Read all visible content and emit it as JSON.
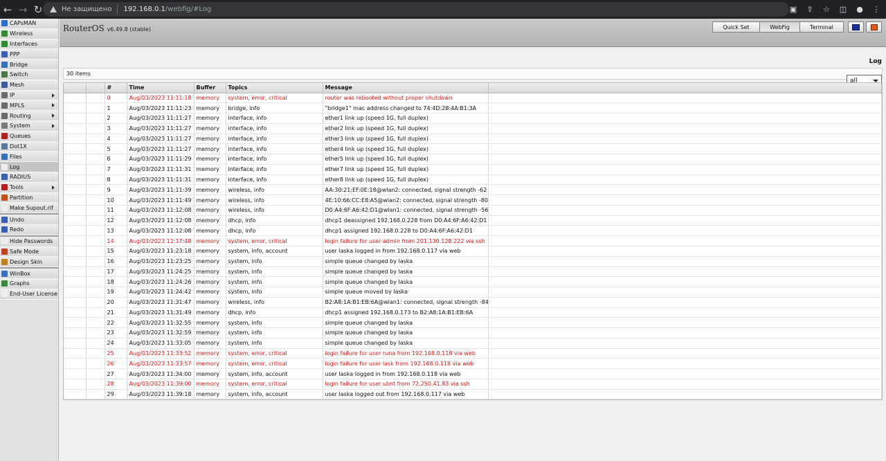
{
  "browser": {
    "security_label": "Не защищено",
    "url_host": "192.168.0.1",
    "url_path": "/webfig/#Log"
  },
  "sidebar": {
    "items": [
      {
        "label": "CAPsMAN",
        "icon": "capsman-icon",
        "color": "#2a6fc9",
        "arrow": false
      },
      {
        "label": "Wireless",
        "icon": "wireless-icon",
        "color": "#3a8a3a",
        "arrow": false
      },
      {
        "label": "Interfaces",
        "icon": "interfaces-icon",
        "color": "#2d8c2d",
        "arrow": false
      },
      {
        "label": "PPP",
        "icon": "ppp-icon",
        "color": "#3a5fb0",
        "arrow": false
      },
      {
        "label": "Bridge",
        "icon": "bridge-icon",
        "color": "#3a6fb8",
        "arrow": false
      },
      {
        "label": "Switch",
        "icon": "switch-icon",
        "color": "#4a7a4a",
        "arrow": false
      },
      {
        "label": "Mesh",
        "icon": "mesh-icon",
        "color": "#3a5f9a",
        "arrow": false
      },
      {
        "label": "IP",
        "icon": "ip-icon",
        "color": "#6a6a6a",
        "arrow": true
      },
      {
        "label": "MPLS",
        "icon": "mpls-icon",
        "color": "#6a6a6a",
        "arrow": true
      },
      {
        "label": "Routing",
        "icon": "routing-icon",
        "color": "#6a6a6a",
        "arrow": true
      },
      {
        "label": "System",
        "icon": "system-icon",
        "color": "#7a7a7a",
        "arrow": true
      },
      {
        "label": "Queues",
        "icon": "queues-icon",
        "color": "#b02020",
        "arrow": false
      },
      {
        "label": "Dot1X",
        "icon": "dot1x-icon",
        "color": "#5a7a9a",
        "arrow": false
      },
      {
        "label": "Files",
        "icon": "files-icon",
        "color": "#3a6fb8",
        "arrow": false
      },
      {
        "label": "Log",
        "icon": "log-icon",
        "color": "#eeeeee",
        "arrow": false,
        "active": true
      },
      {
        "label": "RADIUS",
        "icon": "radius-icon",
        "color": "#3a5fb0",
        "arrow": false
      },
      {
        "label": "Tools",
        "icon": "tools-icon",
        "color": "#b02020",
        "arrow": true
      },
      {
        "label": "Partition",
        "icon": "partition-icon",
        "color": "#c05020",
        "arrow": false
      },
      {
        "label": "Make Supout.rif",
        "icon": "supout-icon",
        "color": "#eeeeee",
        "arrow": false
      }
    ],
    "group2": [
      {
        "label": "Undo",
        "icon": "undo-icon",
        "color": "#3a5fb0"
      },
      {
        "label": "Redo",
        "icon": "redo-icon",
        "color": "#3a5fb0"
      }
    ],
    "group3": [
      {
        "label": "Hide Passwords",
        "icon": "hide-passwords-icon",
        "color": "#eeeeee"
      },
      {
        "label": "Safe Mode",
        "icon": "safe-mode-icon",
        "color": "#c04020"
      },
      {
        "label": "Design Skin",
        "icon": "design-skin-icon",
        "color": "#c08020"
      }
    ],
    "group4": [
      {
        "label": "WinBox",
        "icon": "winbox-icon",
        "color": "#3a6fb8"
      },
      {
        "label": "Graphs",
        "icon": "graphs-icon",
        "color": "#3a8a3a"
      },
      {
        "label": "End-User License",
        "icon": "license-icon",
        "color": "#eeeeee"
      }
    ]
  },
  "header": {
    "brand": "RouterOS",
    "version": "v6.49.8 (stable)",
    "tabs": {
      "quick_set": "Quick Set",
      "webfig": "WebFig",
      "terminal": "Terminal"
    }
  },
  "page": {
    "title": "Log",
    "items_count": "30 items",
    "filter_value": "all"
  },
  "table": {
    "columns": [
      "",
      "",
      "#",
      "Time",
      "Buffer",
      "Topics",
      "Message",
      ""
    ],
    "rows": [
      {
        "n": "0",
        "time": "Aug/03/2023 11:11:18",
        "buffer": "memory",
        "topics": "system, error, critical",
        "message": "router was rebooted without proper shutdown",
        "error": true
      },
      {
        "n": "1",
        "time": "Aug/03/2023 11:11:23",
        "buffer": "memory",
        "topics": "bridge, info",
        "message": "\"bridge1\" mac address changed to 74:4D:28:4A:B1:3A",
        "error": false
      },
      {
        "n": "2",
        "time": "Aug/03/2023 11:11:27",
        "buffer": "memory",
        "topics": "interface, info",
        "message": "ether1 link up (speed 1G, full duplex)",
        "error": false
      },
      {
        "n": "3",
        "time": "Aug/03/2023 11:11:27",
        "buffer": "memory",
        "topics": "interface, info",
        "message": "ether2 link up (speed 1G, full duplex)",
        "error": false
      },
      {
        "n": "4",
        "time": "Aug/03/2023 11:11:27",
        "buffer": "memory",
        "topics": "interface, info",
        "message": "ether3 link up (speed 1G, full duplex)",
        "error": false
      },
      {
        "n": "5",
        "time": "Aug/03/2023 11:11:27",
        "buffer": "memory",
        "topics": "interface, info",
        "message": "ether4 link up (speed 1G, full duplex)",
        "error": false
      },
      {
        "n": "6",
        "time": "Aug/03/2023 11:11:29",
        "buffer": "memory",
        "topics": "interface, info",
        "message": "ether5 link up (speed 1G, full duplex)",
        "error": false
      },
      {
        "n": "7",
        "time": "Aug/03/2023 11:11:31",
        "buffer": "memory",
        "topics": "interface, info",
        "message": "ether7 link up (speed 1G, full duplex)",
        "error": false
      },
      {
        "n": "8",
        "time": "Aug/03/2023 11:11:31",
        "buffer": "memory",
        "topics": "interface, info",
        "message": "ether8 link up (speed 1G, full duplex)",
        "error": false
      },
      {
        "n": "9",
        "time": "Aug/03/2023 11:11:39",
        "buffer": "memory",
        "topics": "wireless, info",
        "message": "AA:30:21:EF:0E:18@wlan2: connected, signal strength -62",
        "error": false
      },
      {
        "n": "10",
        "time": "Aug/03/2023 11:11:49",
        "buffer": "memory",
        "topics": "wireless, info",
        "message": "4E:10:66:CC:E8:A5@wlan2: connected, signal strength -80",
        "error": false
      },
      {
        "n": "11",
        "time": "Aug/03/2023 11:12:08",
        "buffer": "memory",
        "topics": "wireless, info",
        "message": "D0:A4:6F:A6:42:D1@wlan1: connected, signal strength -56",
        "error": false
      },
      {
        "n": "12",
        "time": "Aug/03/2023 11:12:08",
        "buffer": "memory",
        "topics": "dhcp, info",
        "message": "dhcp1 deassigned 192.168.0.228 from D0:A4:6F:A6:42:D1",
        "error": false
      },
      {
        "n": "13",
        "time": "Aug/03/2023 11:12:08",
        "buffer": "memory",
        "topics": "dhcp, info",
        "message": "dhcp1 assigned 192.168.0.228 to D0:A4:6F:A6:42:D1",
        "error": false
      },
      {
        "n": "14",
        "time": "Aug/03/2023 11:17:48",
        "buffer": "memory",
        "topics": "system, error, critical",
        "message": "login failure for user admin from 201.130.128.222 via ssh",
        "error": true
      },
      {
        "n": "15",
        "time": "Aug/03/2023 11:23:18",
        "buffer": "memory",
        "topics": "system, info, account",
        "message": "user laska logged in from 192.168.0.117 via web",
        "error": false
      },
      {
        "n": "16",
        "time": "Aug/03/2023 11:23:25",
        "buffer": "memory",
        "topics": "system, info",
        "message": "simple queue changed by laska",
        "error": false
      },
      {
        "n": "17",
        "time": "Aug/03/2023 11:24:25",
        "buffer": "memory",
        "topics": "system, info",
        "message": "simple queue changed by laska",
        "error": false
      },
      {
        "n": "18",
        "time": "Aug/03/2023 11:24:26",
        "buffer": "memory",
        "topics": "system, info",
        "message": "simple queue changed by laska",
        "error": false
      },
      {
        "n": "19",
        "time": "Aug/03/2023 11:24:42",
        "buffer": "memory",
        "topics": "system, info",
        "message": "simple queue moved by laska",
        "error": false
      },
      {
        "n": "20",
        "time": "Aug/03/2023 11:31:47",
        "buffer": "memory",
        "topics": "wireless, info",
        "message": "B2:A8:1A:B1:EB:6A@wlan1: connected, signal strength -84",
        "error": false
      },
      {
        "n": "21",
        "time": "Aug/03/2023 11:31:49",
        "buffer": "memory",
        "topics": "dhcp, info",
        "message": "dhcp1 assigned 192.168.0.173 to B2:A8:1A:B1:EB:6A",
        "error": false
      },
      {
        "n": "22",
        "time": "Aug/03/2023 11:32:55",
        "buffer": "memory",
        "topics": "system, info",
        "message": "simple queue changed by laska",
        "error": false
      },
      {
        "n": "23",
        "time": "Aug/03/2023 11:32:59",
        "buffer": "memory",
        "topics": "system, info",
        "message": "simple queue changed by laska",
        "error": false
      },
      {
        "n": "24",
        "time": "Aug/03/2023 11:33:05",
        "buffer": "memory",
        "topics": "system, info",
        "message": "simple queue changed by laska",
        "error": false
      },
      {
        "n": "25",
        "time": "Aug/03/2023 11:33:52",
        "buffer": "memory",
        "topics": "system, error, critical",
        "message": "login failure for user runa from 192.168.0.118 via web",
        "error": true
      },
      {
        "n": "26",
        "time": "Aug/03/2023 11:33:57",
        "buffer": "memory",
        "topics": "system, error, critical",
        "message": "login failure for user lask from 192.168.0.118 via web",
        "error": true
      },
      {
        "n": "27",
        "time": "Aug/03/2023 11:34:00",
        "buffer": "memory",
        "topics": "system, info, account",
        "message": "user laska logged in from 192.168.0.118 via web",
        "error": false
      },
      {
        "n": "28",
        "time": "Aug/03/2023 11:39:00",
        "buffer": "memory",
        "topics": "system, error, critical",
        "message": "login failure for user ubnt from 72.250.41.83 via ssh",
        "error": true
      },
      {
        "n": "29",
        "time": "Aug/03/2023 11:39:18",
        "buffer": "memory",
        "topics": "system, info, account",
        "message": "user laska logged out from 192.168.0.117 via web",
        "error": false
      }
    ]
  },
  "colors": {
    "error_text": "#e01818",
    "chrome_bg": "#202124"
  }
}
